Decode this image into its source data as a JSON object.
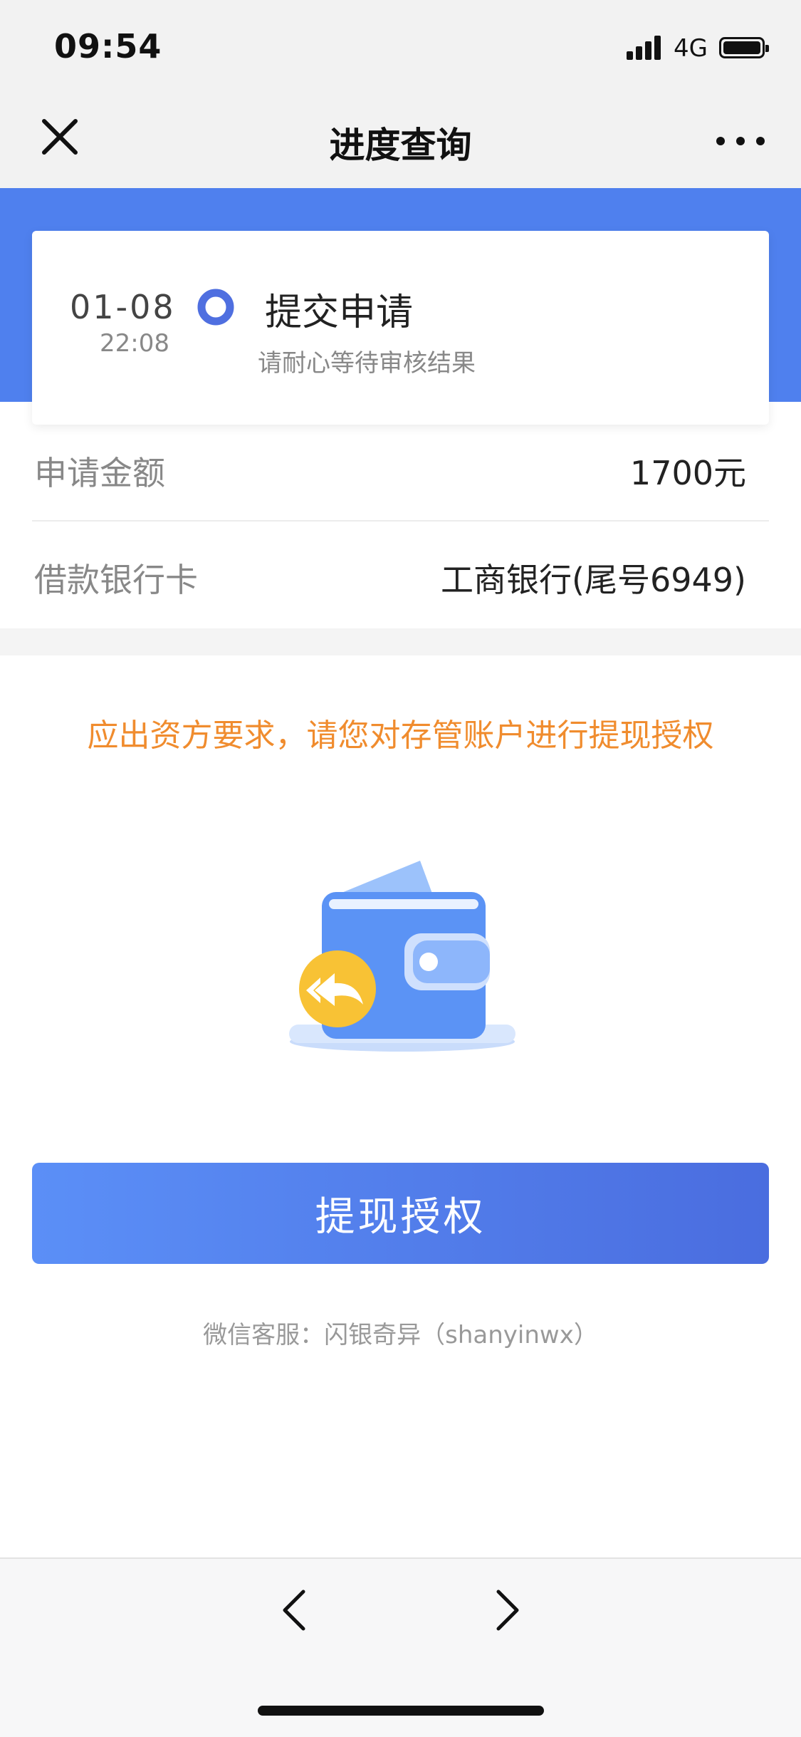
{
  "status_bar": {
    "time": "09:54",
    "network": "4G",
    "battery_icon": "battery-full-icon",
    "signal_icon": "signal-bars-icon"
  },
  "nav": {
    "title": "进度查询",
    "close_icon": "close-icon",
    "more_icon": "more-dots-icon"
  },
  "progress": {
    "date": "01-08",
    "time": "22:08",
    "step_title": "提交申请",
    "step_subtitle": "请耐心等待审核结果",
    "accent_color": "#4f80ee"
  },
  "info": {
    "amount_label": "申请金额",
    "amount_value": "1700元",
    "card_label": "借款银行卡",
    "card_value": "工商银行(尾号6949)"
  },
  "notice": {
    "text": "应出资方要求，请您对存管账户进行提现授权",
    "color": "#f08c2e"
  },
  "illustration_icon": "wallet-icon",
  "action": {
    "button_label": "提现授权"
  },
  "service": {
    "text": "微信客服：闪银奇异（shanyinwx）"
  },
  "bottom_nav": {
    "back_icon": "chevron-left-icon",
    "forward_icon": "chevron-right-icon"
  }
}
